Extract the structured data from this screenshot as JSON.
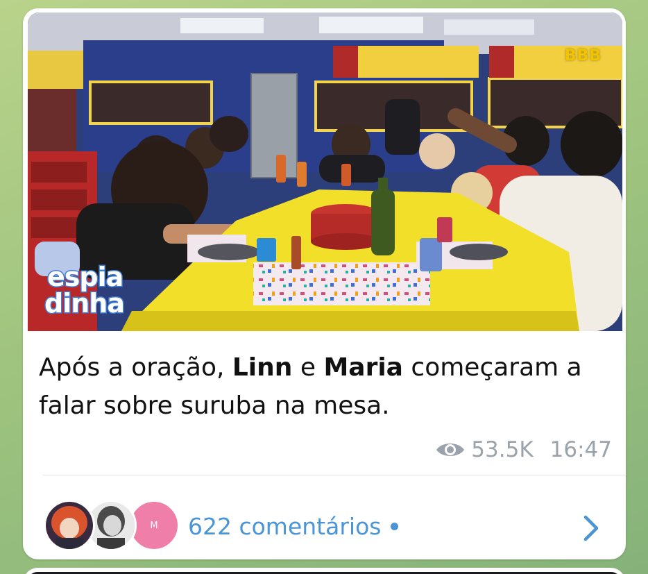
{
  "media": {
    "channel_logo": "BBB",
    "watermark_top": "espia",
    "watermark_bottom": "dinha"
  },
  "caption": {
    "prefix": "Após a oração, ",
    "name_1": "Linn",
    "connector": " e ",
    "name_2": "Maria",
    "suffix": " começaram a falar sobre suruba na mesa."
  },
  "meta": {
    "views": "53.5K",
    "time": "16:47",
    "view_icon": "eye-icon"
  },
  "comments": {
    "label": "622 comentários",
    "avatar_3_initial": "M",
    "chevron_icon": "chevron-right-icon"
  },
  "colors": {
    "accent": "#4b95d6",
    "meta_gray": "#9aa3ab",
    "avatar_pink": "#ef7fa8"
  }
}
